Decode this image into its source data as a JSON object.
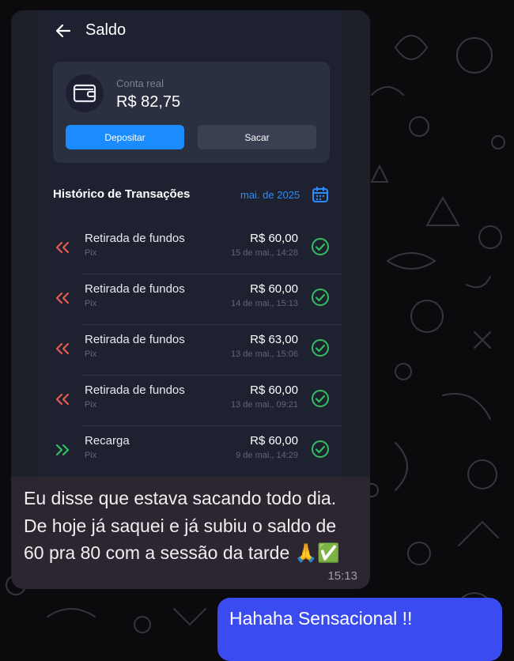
{
  "app": {
    "header_title": "Saldo",
    "account": {
      "label": "Conta real",
      "balance": "R$ 82,75",
      "deposit_label": "Depositar",
      "withdraw_label": "Sacar"
    },
    "history": {
      "title": "Histórico de Transações",
      "period": "mai. de 2025",
      "transactions": [
        {
          "name": "Retirada de fundos",
          "method": "Pix",
          "amount": "R$ 60,00",
          "datetime": "15 de mai., 14:28",
          "direction": "out",
          "status": "completed"
        },
        {
          "name": "Retirada de fundos",
          "method": "Pix",
          "amount": "R$ 60,00",
          "datetime": "14 de mai., 15:13",
          "direction": "out",
          "status": "completed"
        },
        {
          "name": "Retirada de fundos",
          "method": "Pix",
          "amount": "R$ 63,00",
          "datetime": "13 de mai., 15:06",
          "direction": "out",
          "status": "completed"
        },
        {
          "name": "Retirada de fundos",
          "method": "Pix",
          "amount": "R$ 60,00",
          "datetime": "13 de mai., 09:21",
          "direction": "out",
          "status": "completed"
        },
        {
          "name": "Recarga",
          "method": "Pix",
          "amount": "R$ 60,00",
          "datetime": "9 de mai., 14:29",
          "direction": "in",
          "status": "completed"
        }
      ]
    }
  },
  "chat": {
    "incoming_text": "Eu disse que estava sacando todo dia. De hoje já saquei e já subiu o saldo de 60 pra 80 com a sessão da tarde 🙏✅",
    "incoming_time": "15:13",
    "outgoing_text": "Hahaha Sensacional !!"
  },
  "colors": {
    "accent_blue": "#1b8cff",
    "withdraw_red": "#e85a4f",
    "deposit_green": "#2fbf5f",
    "incoming_bubble": "#2c2630",
    "outgoing_bubble": "#3a4cf0"
  }
}
